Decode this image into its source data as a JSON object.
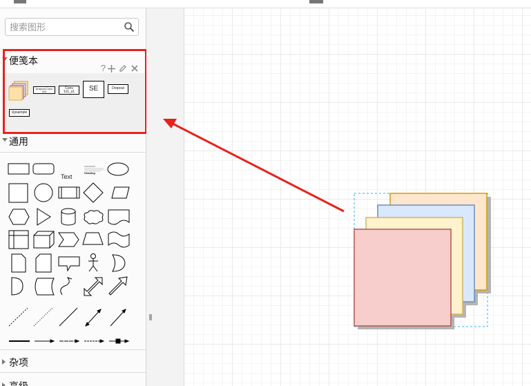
{
  "search": {
    "placeholder": "搜索图形"
  },
  "scratchpad": {
    "title": "便笺本",
    "help_label": "?",
    "items": {
      "dropout_conv": "Dropout Conv 3x3",
      "conv": "Conv 1x1_s1",
      "se": "SE",
      "dropout": "Dropout",
      "upsample": "Upsample"
    }
  },
  "general": {
    "title": "通用",
    "text_shape": "Text",
    "heading_shape": "Heading"
  },
  "misc": {
    "title": "杂项"
  },
  "advanced": {
    "title": "高级"
  },
  "canvas": {
    "layers": [
      {
        "name": "orange-card",
        "fill": "#ffe6cc",
        "stroke": "#d79b00"
      },
      {
        "name": "blue-card",
        "fill": "#dae8fc",
        "stroke": "#6c8ebf"
      },
      {
        "name": "yellow-card",
        "fill": "#fff2cc",
        "stroke": "#d6b656"
      },
      {
        "name": "red-card",
        "fill": "#f8cecc",
        "stroke": "#b85450"
      }
    ],
    "annotation_color": "#e8211a"
  }
}
